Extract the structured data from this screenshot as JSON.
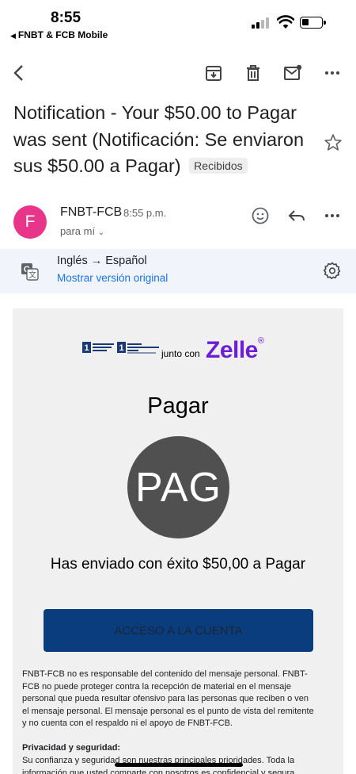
{
  "status": {
    "time": "8:55",
    "back_app": "FNBT & FCB Mobile"
  },
  "toolbar": {
    "icons": [
      "back-arrow-icon",
      "archive-icon",
      "trash-icon",
      "mark-unread-icon",
      "more-icon"
    ]
  },
  "email": {
    "subject": "Notification - Your  $50.00 to Pagar was sent (Notificación: Se enviaron sus $50.00 a Pagar)",
    "label_chip": "Recibidos",
    "sender_initial": "F",
    "sender_name": "FNBT-FCB",
    "time": "8:55 p.m.",
    "to": "para mí"
  },
  "translate": {
    "languages": "Inglés → Español",
    "show_original": "Mostrar versión original"
  },
  "body": {
    "partner_text": "junto con",
    "zelle_logo": "Zelle",
    "title": "Pagar",
    "avatar_text": "PAG",
    "message": "Has enviado con éxito $50,00 a Pagar",
    "cta": "ACCESO A LA CUENTA",
    "disclaimer": "FNBT-FCB no es responsable del contenido del mensaje personal. FNBT-FCB no puede proteger contra la recepción de material en el mensaje personal que pueda resultar ofensivo para las personas que reciben o ven el mensaje personal. El mensaje personal es el punto de vista del remitente y no cuenta con el respaldo ni el apoyo de FNBT-FCB.",
    "privacy_heading": "Privacidad y seguridad:",
    "privacy_text": "Su confianza y seguridad son nuestras principales prioridades. Toda la información que usted comparte con nosotros es confidencial y segura."
  },
  "colors": {
    "avatar": "#e8358a",
    "zelle": "#6d1ed4",
    "cta_bg": "#0a3d7e",
    "link": "#1a73e8"
  }
}
